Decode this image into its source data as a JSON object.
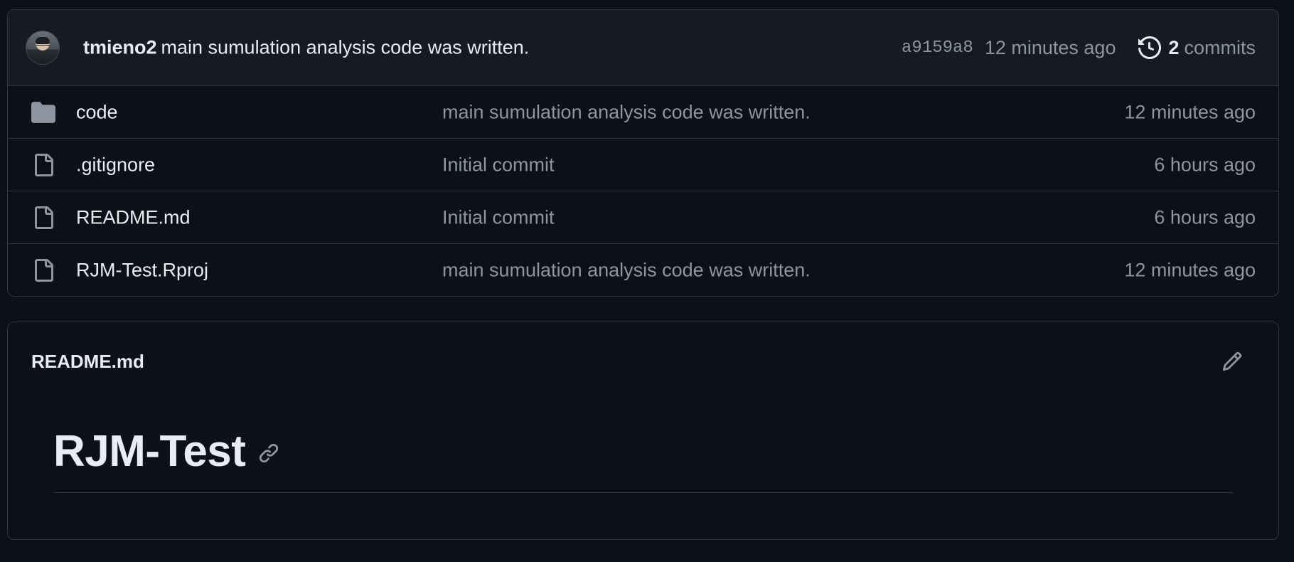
{
  "latest_commit": {
    "author": "tmieno2",
    "message": "main sumulation analysis code was written.",
    "sha": "a9159a8",
    "time": "12 minutes ago",
    "commit_count": "2",
    "commit_word": "commits",
    "history_icon": "history-icon",
    "avatar": "user-avatar"
  },
  "files": [
    {
      "type": "folder",
      "icon": "folder-icon",
      "name": "code",
      "message": "main sumulation analysis code was written.",
      "time": "12 minutes ago"
    },
    {
      "type": "file",
      "icon": "file-icon",
      "name": ".gitignore",
      "message": "Initial commit",
      "time": "6 hours ago"
    },
    {
      "type": "file",
      "icon": "file-icon",
      "name": "README.md",
      "message": "Initial commit",
      "time": "6 hours ago"
    },
    {
      "type": "file",
      "icon": "file-icon",
      "name": "RJM-Test.Rproj",
      "message": "main sumulation analysis code was written.",
      "time": "12 minutes ago"
    }
  ],
  "readme": {
    "filename": "README.md",
    "heading": "RJM-Test",
    "edit_icon": "pencil-icon",
    "anchor_icon": "link-icon"
  },
  "colors": {
    "background": "#0d1117",
    "header_bg": "#161b22",
    "border": "#30363d",
    "text": "#e6edf3",
    "muted": "#8d96a0",
    "icon": "#8d96a0"
  }
}
